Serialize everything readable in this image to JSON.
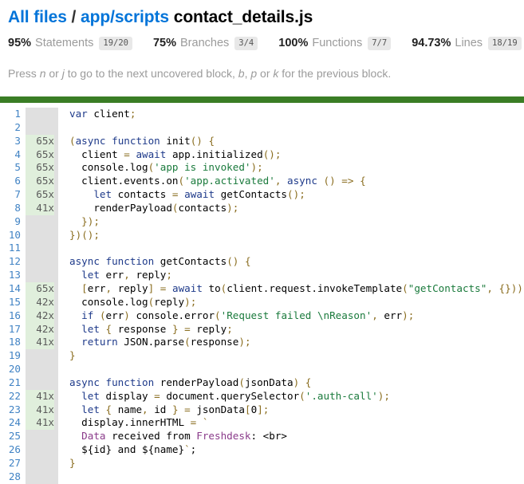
{
  "breadcrumb": {
    "root": "All files",
    "separator": "/",
    "directory": "app/scripts",
    "filename": "contact_details.js"
  },
  "summary": {
    "metrics": [
      {
        "pct": "95%",
        "label": "Statements",
        "fraction": "19/20"
      },
      {
        "pct": "75%",
        "label": "Branches",
        "fraction": "3/4"
      },
      {
        "pct": "100%",
        "label": "Functions",
        "fraction": "7/7"
      },
      {
        "pct": "94.73%",
        "label": "Lines",
        "fraction": "18/19"
      }
    ]
  },
  "hint": {
    "part1": "Press ",
    "key1": "n",
    "part2": " or ",
    "key2": "j",
    "part3": " to go to the next uncovered block, ",
    "key3": "b",
    "part4": ", ",
    "key4": "p",
    "part5": " or ",
    "key5": "k",
    "part6": " for the previous block."
  },
  "colors": {
    "accent_link": "#0074d9",
    "green_bar": "#3a7d25",
    "covered_row": "#e0efdc",
    "gutter_bg": "#e0e0e0",
    "line_number": "#4183c4"
  },
  "code": {
    "line_numbers": [
      "1",
      "2",
      "3",
      "4",
      "5",
      "6",
      "7",
      "8",
      "9",
      "10",
      "11",
      "12",
      "13",
      "14",
      "15",
      "16",
      "17",
      "18",
      "19",
      "20",
      "21",
      "22",
      "23",
      "24",
      "25",
      "26",
      "27",
      "28"
    ],
    "hit_counts": [
      "",
      "",
      "65x",
      "65x",
      "65x",
      "65x",
      "65x",
      "41x",
      "",
      "",
      "",
      "",
      "",
      "65x",
      "42x",
      "42x",
      "42x",
      "41x",
      "",
      "",
      "",
      "41x",
      "41x",
      "41x",
      "",
      "",
      "",
      ""
    ],
    "lines": [
      "var client;",
      "",
      "(async function init() {",
      "  client = await app.initialized();",
      "  console.log('app is invoked');",
      "  client.events.on('app.activated', async () => {",
      "    let contacts = await getContacts();",
      "    renderPayload(contacts);",
      "  });",
      "})();",
      "",
      "async function getContacts() {",
      "  let err, reply;",
      "  [err, reply] = await to(client.request.invokeTemplate(\"getContacts\", {}));",
      "  console.log(reply);",
      "  if (err) console.error('Request failed \\nReason', err);",
      "  let { response } = reply;",
      "  return JSON.parse(response);",
      "}",
      "",
      "async function renderPayload(jsonData) {",
      "  let display = document.querySelector('.auth-call');",
      "  let { name, id } = jsonData[0];",
      "  display.innerHTML = `",
      "  Data received from Freshdesk: <br>",
      "  ${id} and ${name}`;",
      "}",
      ""
    ]
  }
}
